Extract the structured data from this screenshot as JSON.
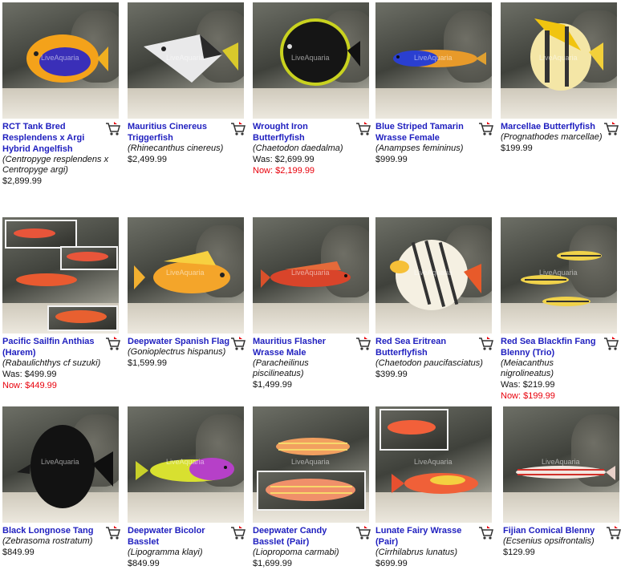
{
  "products": [
    {
      "name": "RCT Tank Bred Resplendens x Argi Hybrid Angelfish",
      "scientific": "(Centropyge resplendens x Centropyge argi)",
      "price": "$2,899.99",
      "was": "",
      "now": ""
    },
    {
      "name": "Mauritius Cinereus Triggerfish",
      "scientific": "(Rhinecanthus cinereus)",
      "price": "$2,499.99",
      "was": "",
      "now": ""
    },
    {
      "name": "Wrought Iron Butterflyfish",
      "scientific": "(Chaetodon daedalma)",
      "price": "",
      "was": "Was: $2,699.99",
      "now": "Now: $2,199.99"
    },
    {
      "name": "Blue Striped Tamarin Wrasse Female",
      "scientific": "(Anampses femininus)",
      "price": "$999.99",
      "was": "",
      "now": ""
    },
    {
      "name": "Marcellae Butterflyfish",
      "scientific": "(Prognathodes marcellae)",
      "price": "$199.99",
      "was": "",
      "now": ""
    },
    {
      "name": "Pacific Sailfin Anthias (Harem)",
      "scientific": "(Rabaulichthys cf suzuki)",
      "price": "",
      "was": "Was: $499.99",
      "now": "Now: $449.99"
    },
    {
      "name": "Deepwater Spanish Flag",
      "scientific": "(Gonioplectrus hispanus)",
      "price": "$1,599.99",
      "was": "",
      "now": ""
    },
    {
      "name": "Mauritius Flasher Wrasse Male",
      "scientific": "(Paracheilinus piscilineatus)",
      "price": "$1,499.99",
      "was": "",
      "now": ""
    },
    {
      "name": "Red Sea Eritrean Butterflyfish",
      "scientific": "(Chaetodon paucifasciatus)",
      "price": "$399.99",
      "was": "",
      "now": ""
    },
    {
      "name": "Red Sea Blackfin Fang Blenny (Trio)",
      "scientific": "(Meiacanthus nigrolineatus)",
      "price": "",
      "was": "Was: $219.99",
      "now": "Now: $199.99"
    },
    {
      "name": "Black Longnose Tang",
      "scientific": "(Zebrasoma rostratum)",
      "price": "$849.99",
      "was": "",
      "now": ""
    },
    {
      "name": "Deepwater Bicolor Basslet",
      "scientific": "(Lipogramma klayi)",
      "price": "$849.99",
      "was": "",
      "now": ""
    },
    {
      "name": "Deepwater Candy Basslet (Pair)",
      "scientific": "(Liopropoma carmabi)",
      "price": "$1,699.99",
      "was": "",
      "now": ""
    },
    {
      "name": "Lunate Fairy Wrasse (Pair)",
      "scientific": "(Cirrhilabrus lunatus)",
      "price": "$699.99",
      "was": "",
      "now": ""
    },
    {
      "name": "Fijian Comical Blenny",
      "scientific": "(Ecsenius opsifrontalis)",
      "price": "$129.99",
      "was": "",
      "now": ""
    }
  ],
  "watermark": "LiveAquaria",
  "icons": {
    "cart": "shopping-cart-icon"
  },
  "colors": {
    "link": "#1f1fbf",
    "sale": "#e8000b",
    "text": "#111111"
  }
}
